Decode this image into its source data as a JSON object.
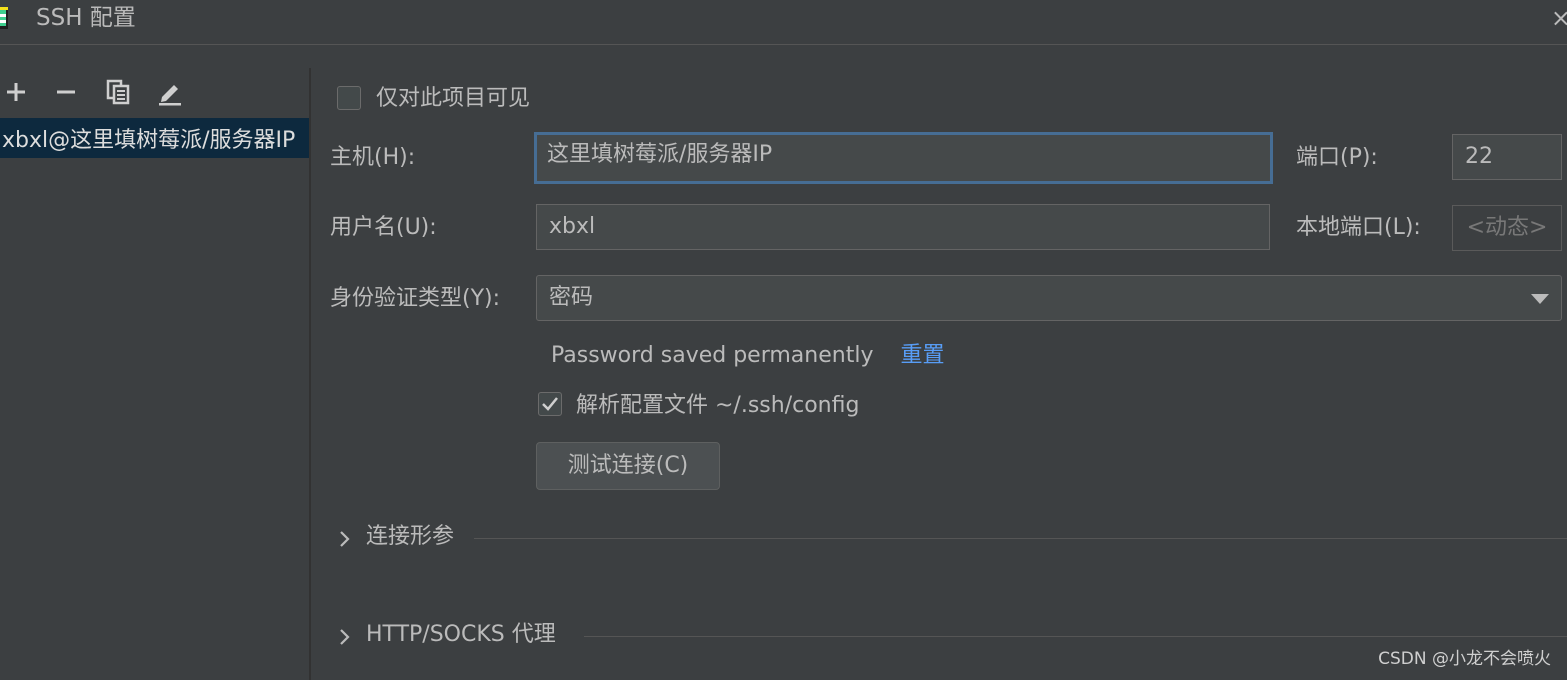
{
  "window": {
    "title": "SSH 配置",
    "close_glyph": "×"
  },
  "toolbar": {
    "add_label": "+",
    "remove_label": "−",
    "copy_icon": "copy-icon",
    "edit_icon": "edit-icon"
  },
  "list": {
    "items": [
      {
        "label": "xbxl@这里填树莓派/服务器IP"
      }
    ]
  },
  "form": {
    "visible_only_project": {
      "label": "仅对此项目可见",
      "checked": false
    },
    "host": {
      "label": "主机(H):",
      "value": "这里填树莓派/服务器IP"
    },
    "port": {
      "label": "端口(P):",
      "value": "22"
    },
    "username": {
      "label": "用户名(U):",
      "value": "xbxl"
    },
    "local_port": {
      "label": "本地端口(L):",
      "placeholder": "<动态>"
    },
    "auth_type": {
      "label": "身份验证类型(Y):",
      "value": "密码"
    },
    "password_status": "Password saved permanently",
    "reset_link": "重置",
    "parse_config": {
      "label": "解析配置文件 ~/.ssh/config",
      "checked": true
    },
    "test_button": "测试连接(C)"
  },
  "sections": [
    {
      "title": "连接形参"
    },
    {
      "title": "HTTP/SOCKS 代理"
    }
  ],
  "watermark": "CSDN @小龙不会喷火",
  "colors": {
    "background": "#3c3f41",
    "selection": "#0d293e",
    "focus_border": "#466d94",
    "link": "#589df6"
  }
}
